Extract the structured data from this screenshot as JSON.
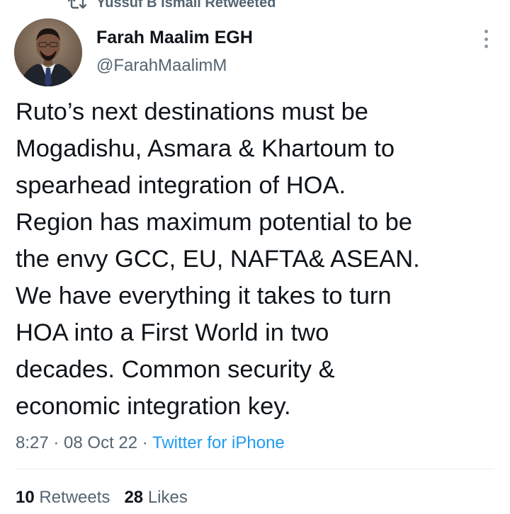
{
  "social_context": {
    "text": "Yussuf B Ismail Retweeted",
    "icon": "retweet-icon"
  },
  "author": {
    "display_name": "Farah Maalim EGH",
    "handle": "@FarahMaalimM"
  },
  "tweet": {
    "lines": [
      "Ruto’s next destinations must be",
      "Mogadishu, Asmara & Khartoum to",
      "spearhead integration of HOA.",
      "Region has maximum potential to be",
      "the envy GCC, EU, NAFTA& ASEAN.",
      "We have everything it takes to turn",
      "HOA into a First World in two",
      "decades. Common security &",
      "economic integration key."
    ],
    "time": "8:27",
    "separator": " · ",
    "date": "08 Oct 22",
    "source": "Twitter for iPhone"
  },
  "stats": {
    "retweets_count": "10",
    "retweets_label": "Retweets",
    "likes_count": "28",
    "likes_label": "Likes"
  },
  "colors": {
    "text": "#0f1419",
    "secondary": "#536471",
    "link": "#1d9bf0"
  }
}
